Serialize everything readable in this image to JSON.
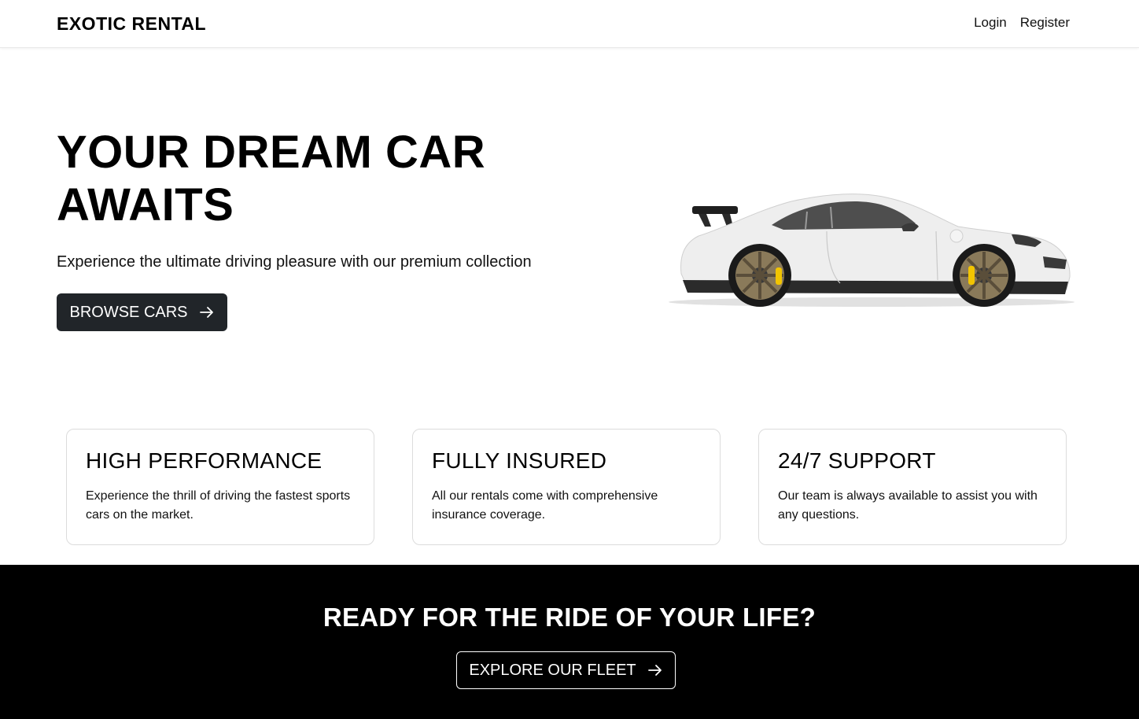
{
  "nav": {
    "brand": "EXOTIC RENTAL",
    "login": "Login",
    "register": "Register"
  },
  "hero": {
    "title": "YOUR DREAM CAR AWAITS",
    "subtitle": "Experience the ultimate driving pleasure with our premium collection",
    "button_label": "BROWSE CARS",
    "button_icon": "arrow-right-icon"
  },
  "features": [
    {
      "title": "HIGH PERFORMANCE",
      "text": "Experience the thrill of driving the fastest sports cars on the market."
    },
    {
      "title": "FULLY INSURED",
      "text": "All our rentals come with comprehensive insurance coverage."
    },
    {
      "title": "24/7 SUPPORT",
      "text": "Our team is always available to assist you with any questions."
    }
  ],
  "cta": {
    "title": "READY FOR THE RIDE OF YOUR LIFE?",
    "button_label": "EXPLORE OUR FLEET",
    "button_icon": "arrow-right-icon"
  },
  "colors": {
    "dark_button": "#212529",
    "cta_background": "#000000",
    "caliper_yellow": "#f2c400"
  }
}
